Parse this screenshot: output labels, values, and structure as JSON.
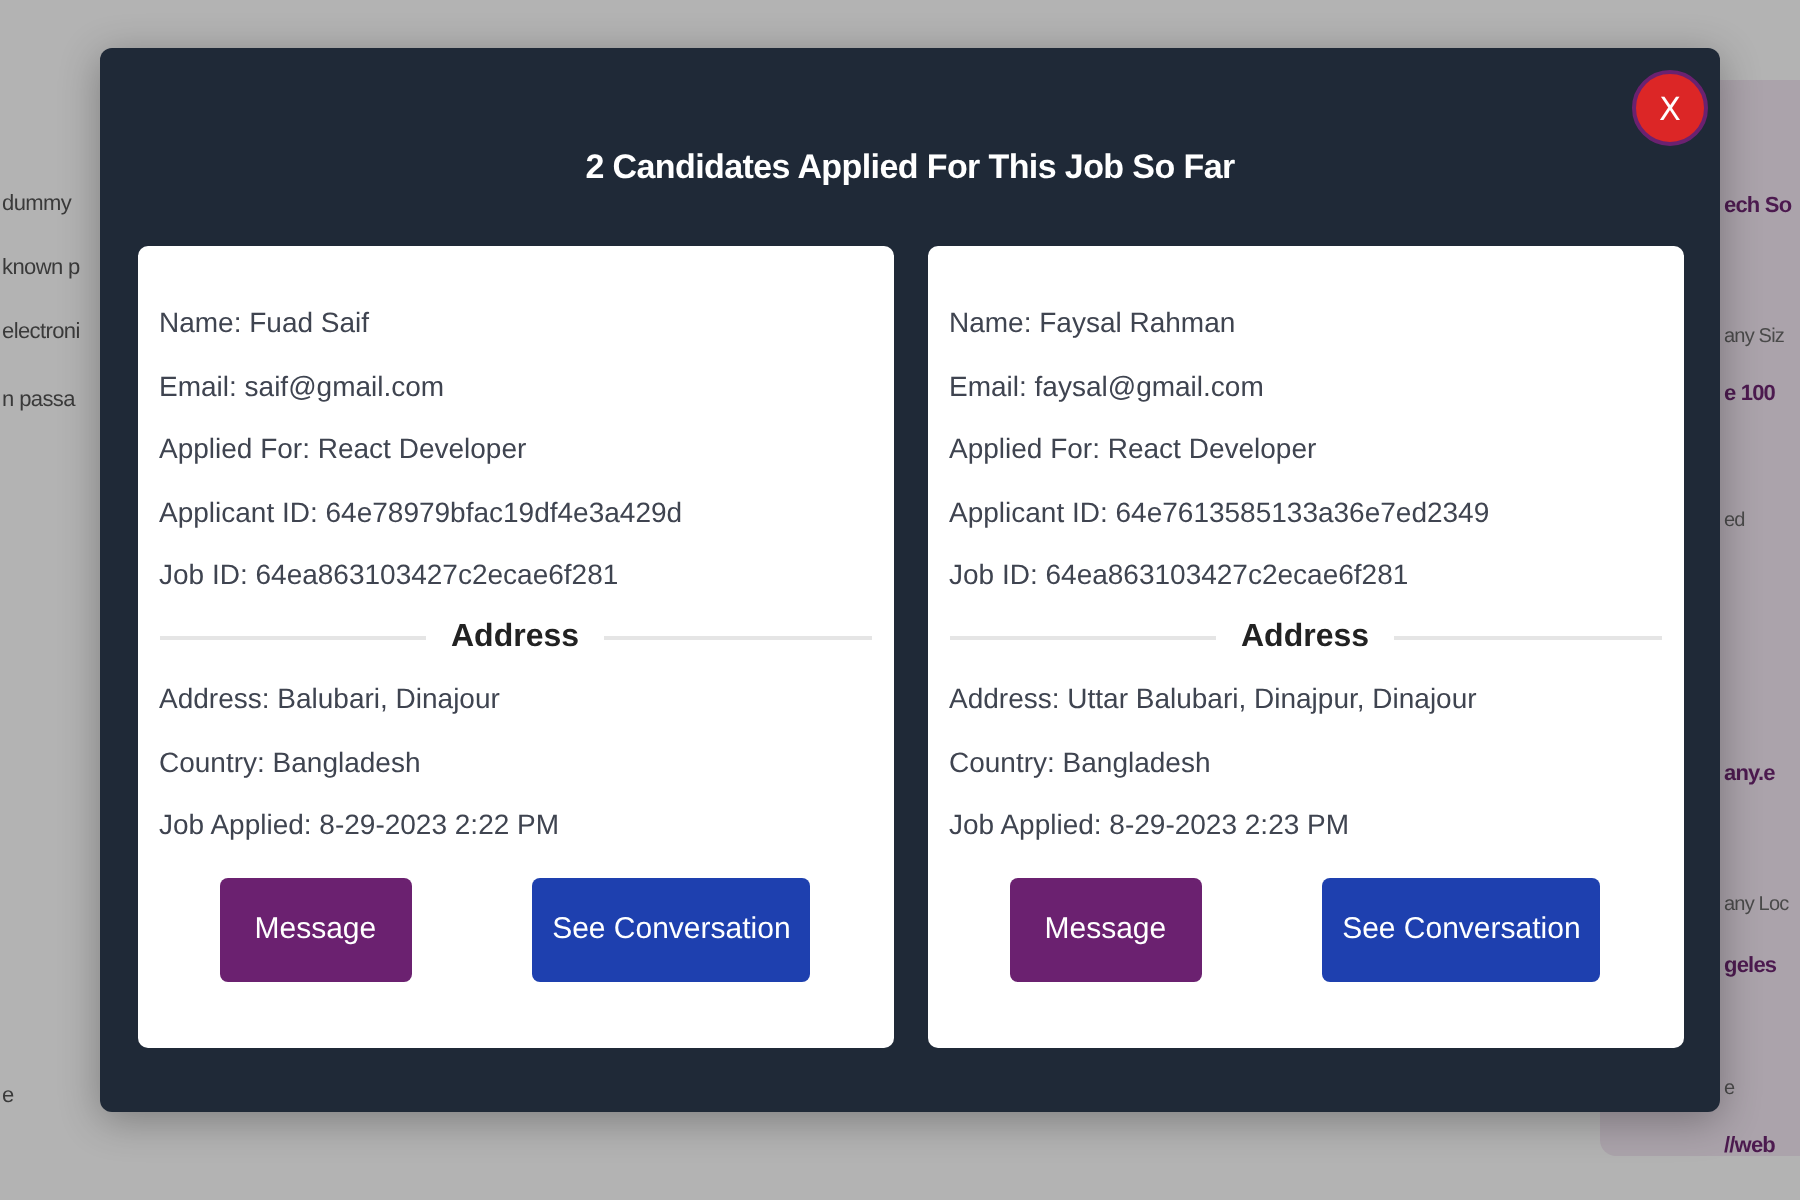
{
  "background": {
    "left_fragments": [
      "dummy",
      "known p",
      "electroni",
      "n passa",
      "e"
    ],
    "right_panel": [
      {
        "kind": "heading",
        "text": "ech So"
      },
      {
        "kind": "label",
        "text": "any Siz"
      },
      {
        "kind": "value",
        "text": "e 100"
      },
      {
        "kind": "label",
        "text": "ed"
      },
      {
        "kind": "value",
        "text": "any.e"
      },
      {
        "kind": "label",
        "text": "any Loc"
      },
      {
        "kind": "value",
        "text": "geles"
      },
      {
        "kind": "label",
        "text": "e"
      },
      {
        "kind": "value",
        "text": "//web"
      }
    ]
  },
  "modal": {
    "title": "2 Candidates Applied For This Job So Far",
    "close": "X",
    "candidates": [
      {
        "details": [
          "Name: Fuad Saif",
          "Email: saif@gmail.com",
          "Applied For: React Developer",
          "Applicant ID: 64e78979bfac19df4e3a429d",
          "Job ID: 64ea863103427c2ecae6f281"
        ],
        "section": "Address",
        "address": [
          "Address: Balubari, Dinajour",
          "Country: Bangladesh",
          "Job Applied: 8-29-2023 2:22 PM"
        ],
        "buttons": [
          "Message",
          "See Conversation"
        ]
      },
      {
        "details": [
          "Name: Faysal Rahman",
          "Email: faysal@gmail.com",
          "Applied For: React Developer",
          "Applicant ID: 64e7613585133a36e7ed2349",
          "Job ID: 64ea863103427c2ecae6f281"
        ],
        "section": "Address",
        "address": [
          "Address: Uttar Balubari, Dinajpur, Dinajour",
          "Country: Bangladesh",
          "Job Applied: 8-29-2023 2:23 PM"
        ],
        "buttons": [
          "Message",
          "See Conversation"
        ]
      }
    ]
  }
}
